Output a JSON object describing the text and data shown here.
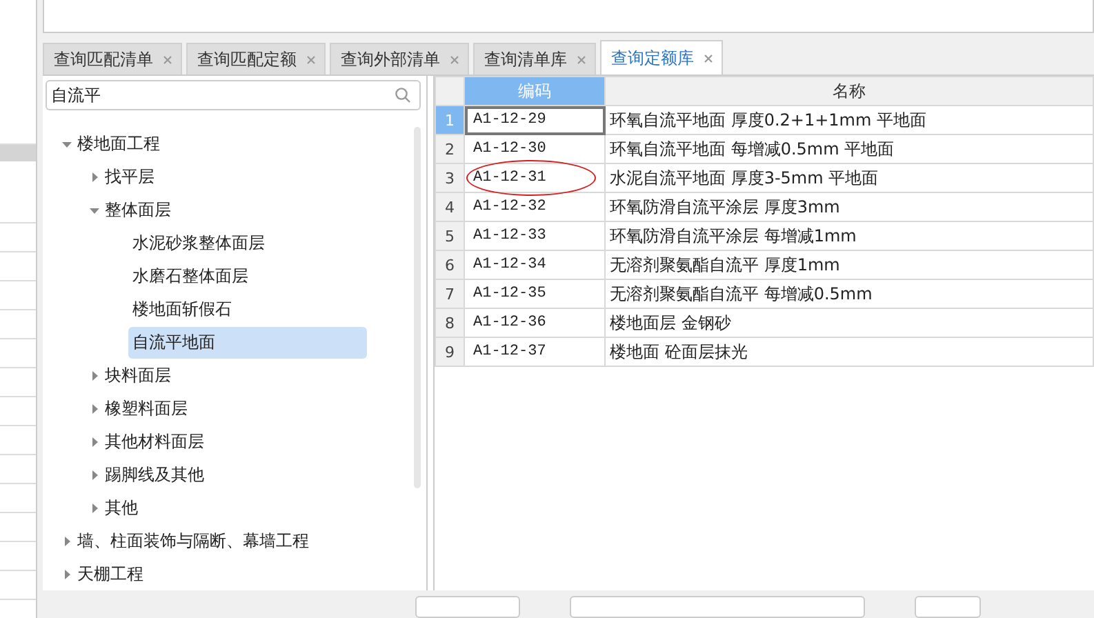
{
  "tabs": [
    {
      "label": "查询匹配清单",
      "selected": false
    },
    {
      "label": "查询匹配定额",
      "selected": false
    },
    {
      "label": "查询外部清单",
      "selected": false
    },
    {
      "label": "查询清单库",
      "selected": false
    },
    {
      "label": "查询定额库",
      "selected": true
    }
  ],
  "search": {
    "value": "自流平"
  },
  "tree": [
    {
      "label": "楼地面工程",
      "kind": "folder",
      "expanded": true,
      "selected": false,
      "children": [
        {
          "label": "找平层",
          "kind": "folder",
          "expanded": false,
          "selected": false
        },
        {
          "label": "整体面层",
          "kind": "folder",
          "expanded": true,
          "selected": false,
          "children": [
            {
              "label": "水泥砂浆整体面层",
              "kind": "leaf",
              "selected": false
            },
            {
              "label": "水磨石整体面层",
              "kind": "leaf",
              "selected": false
            },
            {
              "label": "楼地面斩假石",
              "kind": "leaf",
              "selected": false
            },
            {
              "label": "自流平地面",
              "kind": "leaf",
              "selected": true
            }
          ]
        },
        {
          "label": "块料面层",
          "kind": "folder",
          "expanded": false,
          "selected": false
        },
        {
          "label": "橡塑料面层",
          "kind": "folder",
          "expanded": false,
          "selected": false
        },
        {
          "label": "其他材料面层",
          "kind": "folder",
          "expanded": false,
          "selected": false
        },
        {
          "label": "踢脚线及其他",
          "kind": "folder",
          "expanded": false,
          "selected": false
        },
        {
          "label": "其他",
          "kind": "folder",
          "expanded": false,
          "selected": false
        }
      ]
    },
    {
      "label": "墙、柱面装饰与隔断、幕墙工程",
      "kind": "folder",
      "expanded": false,
      "selected": false
    },
    {
      "label": "天棚工程",
      "kind": "folder",
      "expanded": false,
      "selected": false
    }
  ],
  "table": {
    "columns": [
      {
        "label": "编码",
        "selected": true
      },
      {
        "label": "名称",
        "selected": false
      }
    ],
    "rows": [
      {
        "number": "1",
        "code": "A1-12-29",
        "name": "环氧自流平地面 厚度0.2+1+1mm 平地面",
        "selected": true
      },
      {
        "number": "2",
        "code": "A1-12-30",
        "name": "环氧自流平地面 每增减0.5mm 平地面",
        "selected": false
      },
      {
        "number": "3",
        "code": "A1-12-31",
        "name": "水泥自流平地面 厚度3-5mm 平地面",
        "selected": false,
        "circled": true
      },
      {
        "number": "4",
        "code": "A1-12-32",
        "name": "环氧防滑自流平涂层 厚度3mm",
        "selected": false
      },
      {
        "number": "5",
        "code": "A1-12-33",
        "name": "环氧防滑自流平涂层 每增减1mm",
        "selected": false
      },
      {
        "number": "6",
        "code": "A1-12-34",
        "name": "无溶剂聚氨酯自流平 厚度1mm",
        "selected": false
      },
      {
        "number": "7",
        "code": "A1-12-35",
        "name": "无溶剂聚氨酯自流平 每增减0.5mm",
        "selected": false
      },
      {
        "number": "8",
        "code": "A1-12-36",
        "name": "楼地面层 金钢砂",
        "selected": false
      },
      {
        "number": "9",
        "code": "A1-12-37",
        "name": "楼地面 砼面层抹光",
        "selected": false
      }
    ]
  }
}
